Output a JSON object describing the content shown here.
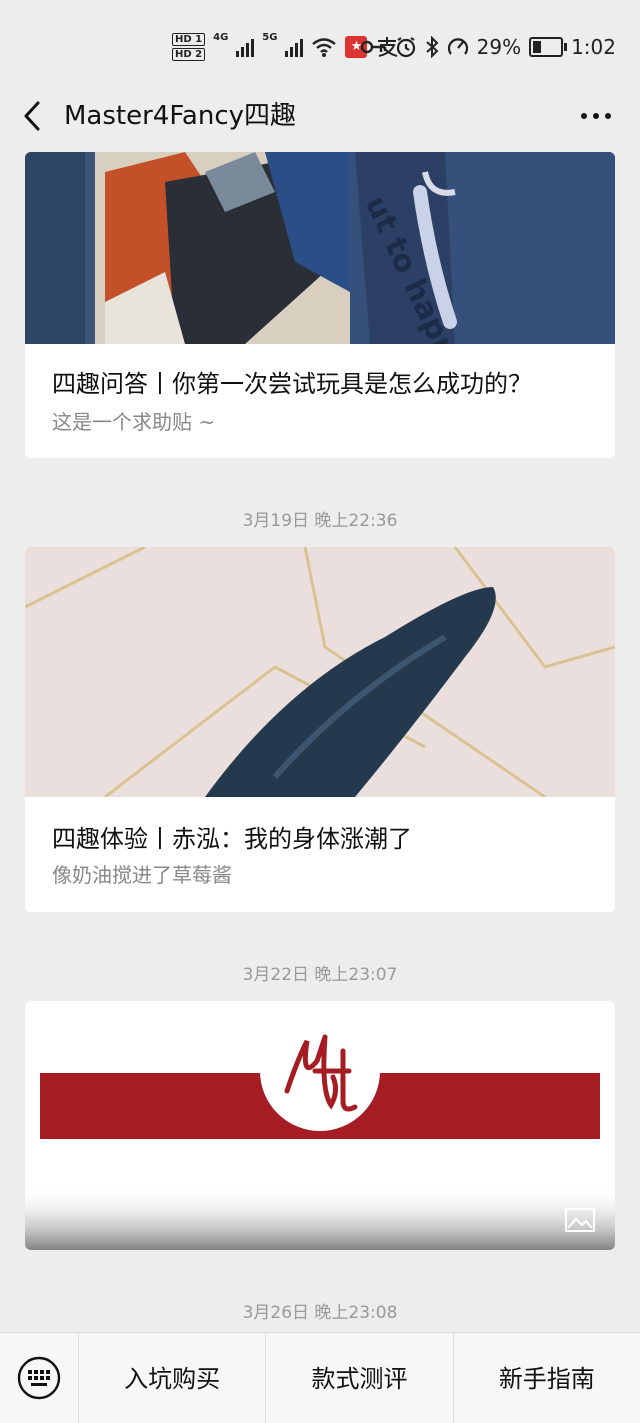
{
  "status": {
    "hd1": "HD 1",
    "hd2": "HD 2",
    "net1": "4G",
    "net2": "5G",
    "battery_pct": "29%",
    "battery_level": 0.29,
    "time": "1:02",
    "icons": [
      "key-icon",
      "alarm-icon",
      "bluetooth-icon",
      "speed-icon",
      "battery-icon"
    ]
  },
  "nav": {
    "title": "Master4Fancy四趣"
  },
  "articles": [
    {
      "title": "四趣问答丨你第一次尝试玩具是怎么成功的？",
      "subtitle": "这是一个求助贴 ~",
      "cover_text": "ut to happe"
    },
    {
      "timestamp": "3月19日 晚上22:36",
      "title": "四趣体验丨赤泓：我的身体涨潮了",
      "subtitle": "像奶油搅进了草莓酱"
    },
    {
      "timestamp": "3月22日 晚上23:07",
      "banner_color": "#a51d22"
    },
    {
      "timestamp": "3月26日 晚上23:08"
    }
  ],
  "bottom_menu": [
    {
      "label": "入坑购买"
    },
    {
      "label": "款式测评"
    },
    {
      "label": "新手指南"
    }
  ]
}
